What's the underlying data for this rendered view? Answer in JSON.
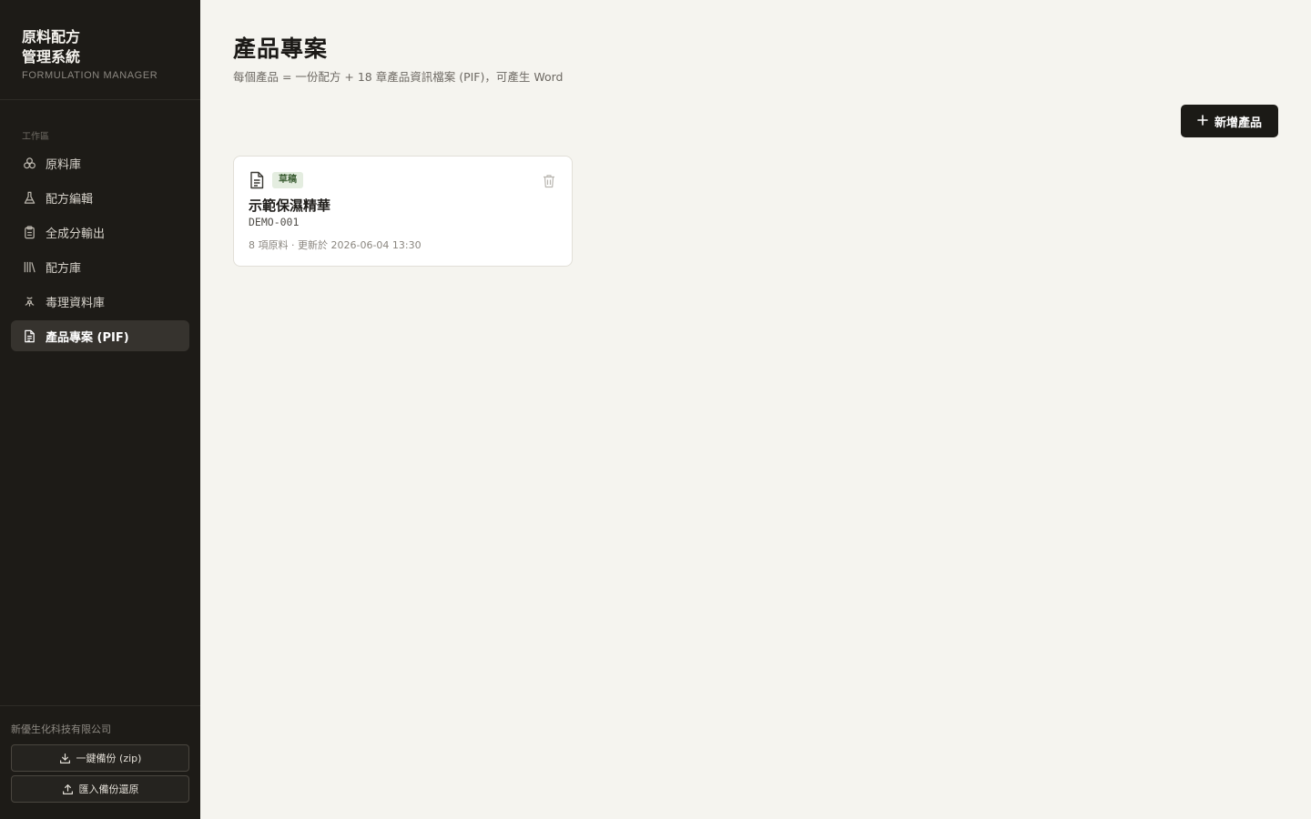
{
  "brand": {
    "title_line1": "原料配方",
    "title_line2": "管理系統",
    "subtitle": "FORMULATION MANAGER"
  },
  "nav": {
    "section_label": "工作區",
    "items": [
      {
        "label": "原料庫",
        "icon": "ingredients-icon",
        "active": false
      },
      {
        "label": "配方編輯",
        "icon": "flask-icon",
        "active": false
      },
      {
        "label": "全成分輸出",
        "icon": "clipboard-icon",
        "active": false
      },
      {
        "label": "配方庫",
        "icon": "library-icon",
        "active": false
      },
      {
        "label": "毒理資料庫",
        "icon": "biohazard-icon",
        "active": false
      },
      {
        "label": "產品專案 (PIF)",
        "icon": "document-icon",
        "active": true
      }
    ]
  },
  "footer": {
    "company": "新優生化科技有限公司",
    "backup_label": "一鍵備份 (zip)",
    "restore_label": "匯入備份還原"
  },
  "header": {
    "title": "產品專案",
    "subtitle": "每個產品 = 一份配方 + 18 章產品資訊檔案 (PIF)，可產生 Word"
  },
  "actions": {
    "new_product_label": "新增產品"
  },
  "products": [
    {
      "status": "草稿",
      "name": "示範保濕精華",
      "code": "DEMO-001",
      "meta": "8 項原料 · 更新於 2026-06-04 13:30"
    }
  ],
  "colors": {
    "sidebar_bg": "#1d1b17",
    "page_bg": "#f5f4ef",
    "primary_button": "#1b1a16",
    "badge_bg": "#e4ede0",
    "badge_text": "#3c5e34"
  }
}
